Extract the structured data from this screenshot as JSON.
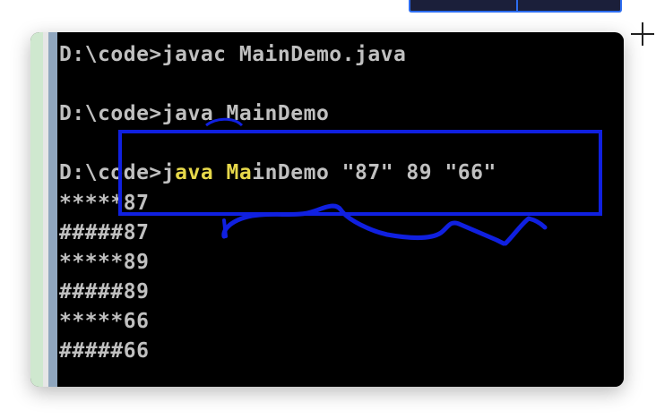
{
  "terminal": {
    "lines": [
      "D:\\code>javac MainDemo.java",
      "",
      "D:\\code>java MainDemo",
      "",
      "D:\\code>java MainDemo \"87\" 89 \"66\"",
      "*****87",
      "#####87",
      "*****89",
      "#####89",
      "*****66",
      "#####66"
    ],
    "line3_parts": {
      "prefix": "D:\\code>j",
      "hl1": "ava ",
      "mid": "",
      "hl2": "Ma",
      "rest": "inDemo \"87\" 89 \"66\""
    }
  },
  "colors": {
    "console_bg": "#000000",
    "console_text": "#c0c0c0",
    "highlight_text": "#e6d84a",
    "annotation_blue": "#1020e0",
    "thumb_border": "#2d6df0"
  }
}
